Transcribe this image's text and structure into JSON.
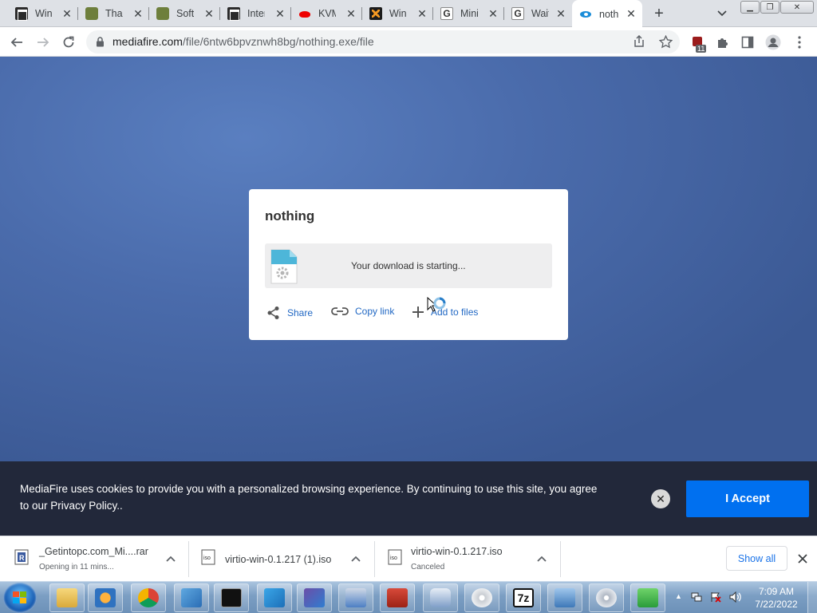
{
  "browser": {
    "tabs": [
      {
        "title": "Win",
        "favicon": "dark-building-icon"
      },
      {
        "title": "Thar",
        "favicon": "tool-icon"
      },
      {
        "title": "Softv",
        "favicon": "tool-icon"
      },
      {
        "title": "Inter",
        "favicon": "dark-building-icon"
      },
      {
        "title": "KVM",
        "favicon": "redhat-icon"
      },
      {
        "title": "Wind",
        "favicon": "x-icon"
      },
      {
        "title": "Mini",
        "favicon": "g-icon"
      },
      {
        "title": "Wait",
        "favicon": "g-icon"
      },
      {
        "title": "noth",
        "favicon": "mediafire-icon",
        "active": true
      }
    ],
    "url_host": "mediafire.com",
    "url_path": "/file/6ntw6bpvznwh8bg/nothing.exe/file",
    "extension_badge": "11"
  },
  "page": {
    "file_name": "nothing",
    "download_message": "Your download is starting...",
    "actions": {
      "share": "Share",
      "copy_link": "Copy link",
      "add_to_files": "Add to files"
    }
  },
  "cookie_banner": {
    "text": "MediaFire uses cookies to provide you with a personalized browsing experience. By continuing to use this site, you agree to our Privacy Policy..",
    "accept_label": "I Accept"
  },
  "downloads": {
    "items": [
      {
        "name": "_Getintopc.com_Mi....rar",
        "status": "Opening in 11 mins..."
      },
      {
        "name": "virtio-win-0.1.217 (1).iso",
        "status": ""
      },
      {
        "name": "virtio-win-0.1.217.iso",
        "status": "Canceled"
      }
    ],
    "show_all": "Show all"
  },
  "taskbar": {
    "time": "7:09 AM",
    "date": "7/22/2022",
    "apps": [
      "explorer-icon",
      "media-player-icon",
      "chrome-icon",
      "control-panel-icon",
      "cmd-icon",
      "remote-desktop-icon",
      "virtualbox-icon",
      "network-icon",
      "toolbox-icon",
      "drive-icon",
      "disc-icon",
      "7zip-icon",
      "computer-network-icon",
      "cd-rom-icon",
      "green-app-icon"
    ]
  },
  "colors": {
    "page_background": "#4a6bab",
    "accept_button": "#0070f0",
    "cookie_background": "#22283a",
    "link_blue": "#2168c4"
  }
}
